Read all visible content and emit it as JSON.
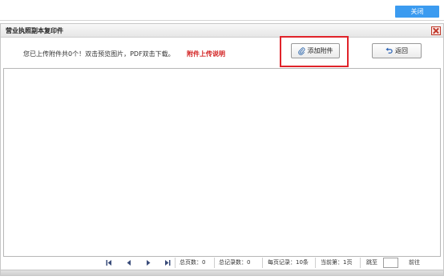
{
  "top_bar": {
    "close_label": "关闭"
  },
  "dialog": {
    "title": "营业执照副本复印件",
    "info_text": "您已上传附件共0个！双击预览图片，PDF双击下载。",
    "upload_help_link": "附件上传说明",
    "add_attachment_label": "添加附件",
    "back_label": "返回"
  },
  "pager": {
    "total_pages": "总页数：0",
    "total_records": "总记录数：0",
    "per_page": "每页记录：10条",
    "current_page": "当前第：1页",
    "jump_to": "跳至",
    "jump_value": "",
    "go_label": "前往"
  },
  "colors": {
    "accent_button": "#3b9bf0",
    "highlight_red": "#e0232a",
    "help_link_red": "#d21f1f"
  },
  "icons": [
    "paperclip-icon",
    "undo-icon",
    "close-x-icon",
    "first-page-icon",
    "prev-page-icon",
    "next-page-icon",
    "last-page-icon"
  ]
}
